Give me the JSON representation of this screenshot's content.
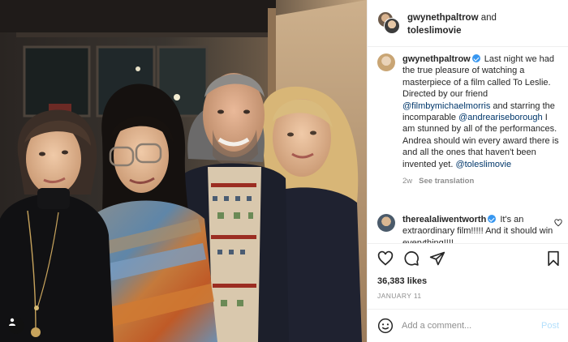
{
  "header": {
    "user_a": "gwynethpaltrow",
    "joiner": "and",
    "user_b": "toleslimovie"
  },
  "caption": {
    "username": "gwynethpaltrow",
    "text_1": "Last night we had the true pleasure of watching a masterpiece of a film called To Leslie. Directed by our friend",
    "mention_1": "@filmbymichaelmorris",
    "text_2": "and starring the incomparable",
    "mention_2": "@andreariseborough",
    "text_3": "I am stunned by all of the performances. Andrea should win every award there is and all the ones that haven't been invented yet.",
    "mention_3": "@toleslimovie",
    "age": "2w",
    "translate": "See translation"
  },
  "comment": {
    "username": "therealaliwentworth",
    "text": "It's an extraordinary film!!!!! And it should win everything!!!!"
  },
  "likes": "36,383 likes",
  "date": "JANUARY 11",
  "add_comment": {
    "placeholder": "Add a comment...",
    "post_label": "Post"
  },
  "icons": {
    "avatar": "avatar",
    "verified": "verified-badge-icon",
    "like": "heart-icon",
    "comment": "comment-icon",
    "share": "paper-plane-icon",
    "save": "bookmark-icon",
    "emoji": "smiley-icon",
    "tags": "person-tag-icon"
  },
  "colors": {
    "link": "#00376b",
    "verified": "#3897f0",
    "muted": "#8e8e8e",
    "post_disabled": "#b2dffc"
  }
}
